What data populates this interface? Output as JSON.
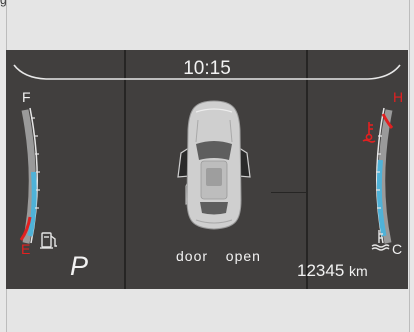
{
  "header": {
    "fragment_text": "g"
  },
  "cluster": {
    "time": "10:15",
    "gear": "P",
    "door_status": "door  open",
    "odometer": {
      "value": "12345",
      "unit": "km"
    }
  },
  "fuel_gauge": {
    "full_label": "F",
    "empty_label": "E",
    "icon": "fuel-pump-icon",
    "level": 0.3
  },
  "temp_gauge": {
    "hot_label": "H",
    "cold_label": "C",
    "icon": "coolant-temperature-icon",
    "level": 0.6
  },
  "colors": {
    "background": "#413f3e",
    "text": "#f2f2f2",
    "gauge_blue": "#4fb2d8",
    "warning_red": "#e22020"
  }
}
